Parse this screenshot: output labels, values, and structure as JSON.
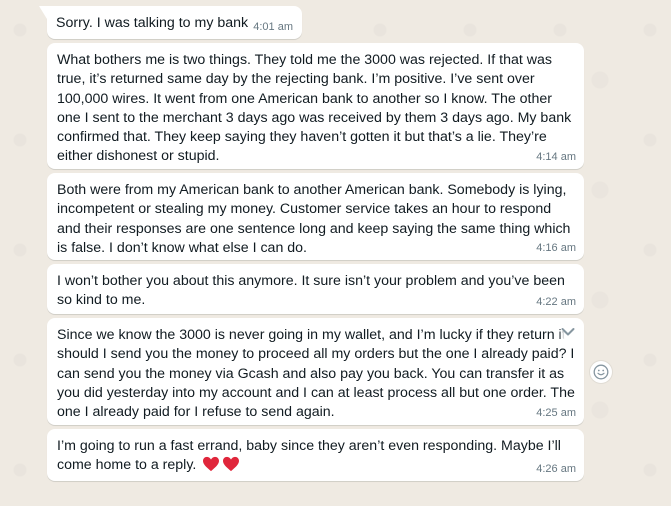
{
  "messages": [
    {
      "text": "Sorry. I was talking to my bank",
      "time": "4:01 am"
    },
    {
      "text": "What bothers me is two things. They told me the 3000 was rejected. If that was true, it’s returned same day by the rejecting bank. I’m positive. I’ve sent over 100,000 wires. It went from one American bank to another so I know. The other one I sent to the merchant 3 days ago was received by them 3 days ago. My bank confirmed that. They keep saying they haven’t gotten it but that’s a lie. They’re either dishonest or stupid.",
      "time": "4:14 am"
    },
    {
      "text": "Both were from my American bank to another American bank. Somebody is lying, incompetent or stealing my money. Customer service takes an hour to respond and their responses are one sentence long and keep saying the same thing which is false. I don’t know what else I can do.",
      "time": "4:16 am"
    },
    {
      "text": "I won’t bother you about this anymore. It sure isn’t your problem and you’ve been so kind to me.",
      "time": "4:22 am"
    },
    {
      "text": "Since we know the 3000 is never going in my wallet, and I’m lucky if they return it should I send you the money to proceed all my orders but the one I already paid? I can send you the money via Gcash and also pay you back. You can transfer it as you did yesterday into my account and I can at least process all but one order. The one I already paid for I refuse to send again.",
      "time": "4:25 am"
    },
    {
      "text": "I’m going to run a fast errand, baby since they aren’t even responding. Maybe I’ll come home to a reply.",
      "emoji": "❤️❤️",
      "time": "4:26 am"
    }
  ],
  "icons": {
    "menu": "chevron-down-icon",
    "react": "smiley-icon",
    "heart": "red-heart-icon"
  },
  "colors": {
    "background": "#efeae2",
    "bubble": "#ffffff",
    "text": "#111b21",
    "timestamp": "#667781",
    "heart": "#e0263b"
  }
}
